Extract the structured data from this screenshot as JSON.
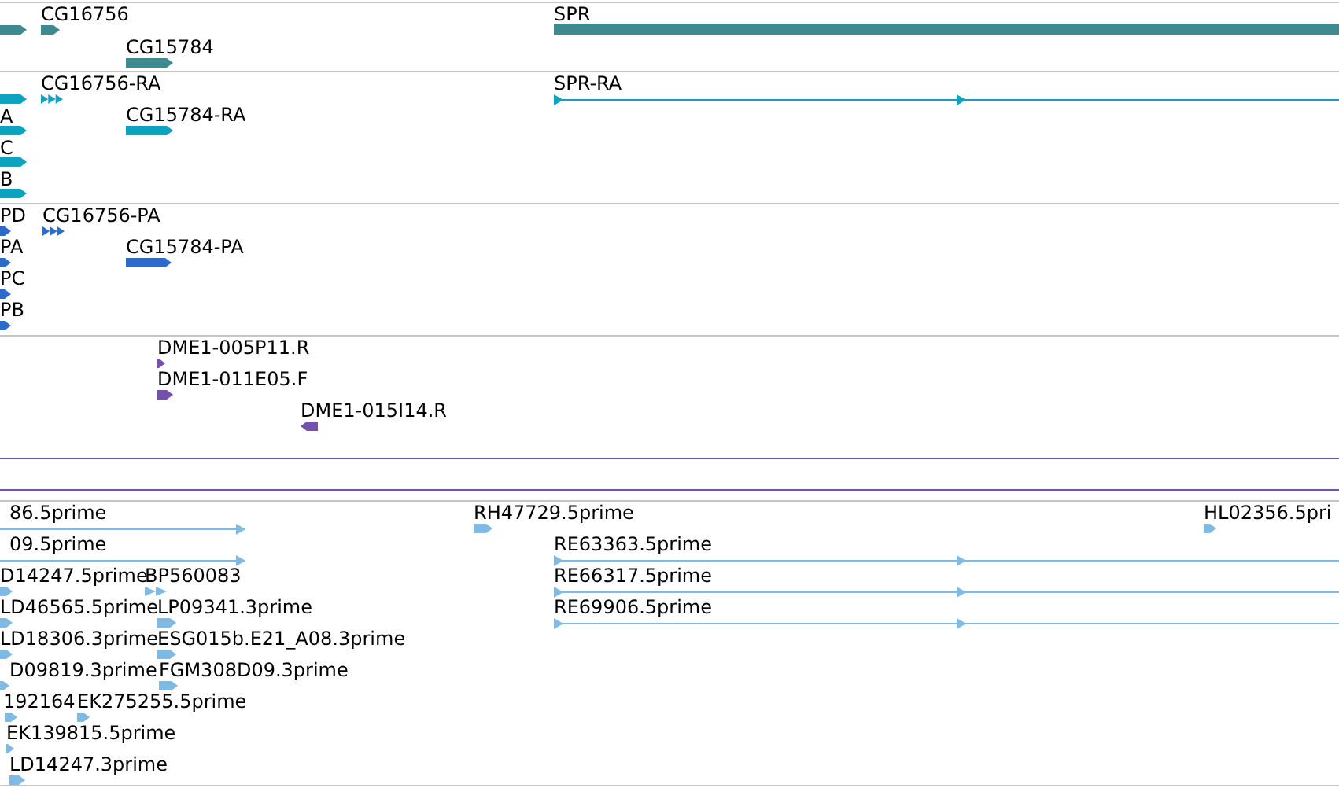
{
  "tracks": [
    {
      "color": "#3d8b8f",
      "features": [
        {
          "kind": "block"
        },
        {
          "label": "CG16756",
          "kind": "block"
        },
        {
          "label": "CG15784",
          "kind": "block"
        },
        {
          "label": "SPR",
          "kind": "bar"
        }
      ]
    },
    {
      "color": "#0ba3c0",
      "features": [
        {
          "kind": "block"
        },
        {
          "label": "A",
          "kind": "block"
        },
        {
          "label": "C",
          "kind": "block"
        },
        {
          "label": "B",
          "kind": "block"
        },
        {
          "label": "CG16756-RA",
          "kind": "arrows"
        },
        {
          "label": "CG15784-RA",
          "kind": "block"
        },
        {
          "label": "SPR-RA",
          "kind": "line"
        }
      ]
    },
    {
      "color": "#2e6acb",
      "features": [
        {
          "label": "PD",
          "kind": "block"
        },
        {
          "label": "PA",
          "kind": "block"
        },
        {
          "label": "PC",
          "kind": "block"
        },
        {
          "label": "PB",
          "kind": "block"
        },
        {
          "label": "CG16756-PA",
          "kind": "arrows"
        },
        {
          "label": "CG15784-PA",
          "kind": "block"
        }
      ]
    },
    {
      "color": "#7650ae",
      "features": [
        {
          "label": "DME1-005P11.R",
          "kind": "block"
        },
        {
          "label": "DME1-011E05.F",
          "kind": "block"
        },
        {
          "label": "DME1-015I14.R",
          "kind": "reverse"
        },
        {
          "kind": "rule"
        },
        {
          "kind": "rule"
        }
      ]
    },
    {
      "color": "#80b9e2",
      "features": [
        {
          "label": "86.5prime",
          "kind": "line"
        },
        {
          "label": "09.5prime",
          "kind": "line"
        },
        {
          "label": "D14247.5prime",
          "kind": "block"
        },
        {
          "label": "BP560083",
          "kind": "arrows"
        },
        {
          "label": "LD46565.5prime",
          "kind": "block"
        },
        {
          "label": "LP09341.3prime",
          "kind": "block"
        },
        {
          "label": "LD18306.3prime",
          "kind": "block"
        },
        {
          "label": "ESG015b.E21_A08.3prime",
          "kind": "block"
        },
        {
          "label": "D09819.3prime",
          "kind": "block"
        },
        {
          "label": "FGM308D09.3prime",
          "kind": "block"
        },
        {
          "label": "192164",
          "kind": "block"
        },
        {
          "label": "EK275255.5prime",
          "kind": "block"
        },
        {
          "label": "EK139815.5prime",
          "kind": "block"
        },
        {
          "label": "LD14247.3prime",
          "kind": "block"
        },
        {
          "label": "RH47729.5prime",
          "kind": "block"
        },
        {
          "label": "HL02356.5pri",
          "kind": "block"
        },
        {
          "label": "RE63363.5prime",
          "kind": "line"
        },
        {
          "label": "RE66317.5prime",
          "kind": "line"
        },
        {
          "label": "RE69906.5prime",
          "kind": "line"
        }
      ]
    }
  ]
}
